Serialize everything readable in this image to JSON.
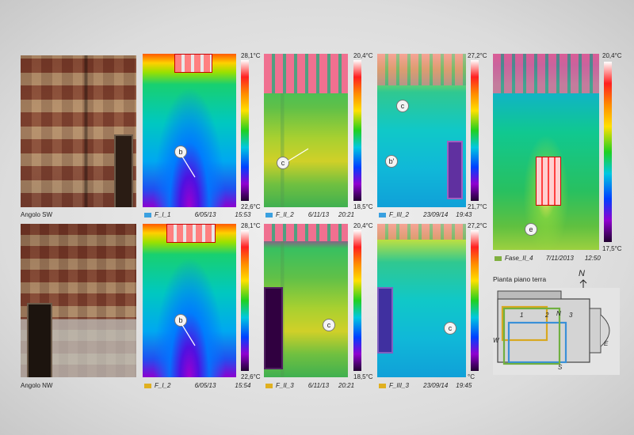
{
  "photos": [
    {
      "caption": "Angolo SW"
    },
    {
      "caption": "Angolo NW"
    }
  ],
  "thermograms": [
    {
      "id": "F_I_1",
      "date": "6/05/13",
      "time": "15:53",
      "tmax": "28,1°C",
      "tmin": "22,6°C",
      "label": "b",
      "color": "#3aa0e0"
    },
    {
      "id": "F_II_2",
      "date": "6/11/13",
      "time": "20:21",
      "tmax": "20,4°C",
      "tmin": "18,5°C",
      "label": "c",
      "color": "#3aa0e0"
    },
    {
      "id": "F_III_2",
      "date": "23/09/14",
      "time": "19:43",
      "tmax": "27,2°C",
      "tmin": "21,7°C",
      "label": "c",
      "label2": "b'",
      "color": "#3aa0e0"
    },
    {
      "id": "F_I_2",
      "date": "6/05/13",
      "time": "15:54",
      "tmax": "28,1°C",
      "tmin": "22,6°C",
      "label": "b",
      "color": "#e0b020"
    },
    {
      "id": "F_II_3",
      "date": "6/11/13",
      "time": "20:21",
      "tmax": "20,4°C",
      "tmin": "18,5°C",
      "label": "c",
      "color": "#e0b020"
    },
    {
      "id": "F_III_3",
      "date": "23/09/14",
      "time": "19:45",
      "tmax": "27,2°C",
      "tmin": "°C",
      "label": "c",
      "color": "#e0b020"
    }
  ],
  "big": {
    "id": "Fase_II_4",
    "date": "7/11/2013",
    "time": "12:50",
    "tmax": "20,4°C",
    "tmin": "17,5°C",
    "label": "e",
    "color": "#80b040"
  },
  "markers": {
    "one": "1",
    "two": "2",
    "three": "3"
  },
  "plan": {
    "title": "Pianta piano terra",
    "north": "N",
    "w": "W",
    "s": "S",
    "e": "E",
    "n_mark": "N"
  }
}
